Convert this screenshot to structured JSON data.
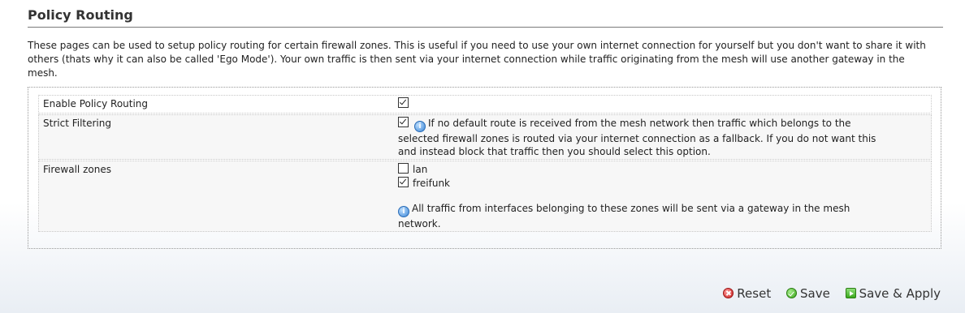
{
  "page": {
    "title": "Policy Routing",
    "description": "These pages can be used to setup policy routing for certain firewall zones. This is useful if you need to use your own internet connection for yourself but you don't want to share it with others (thats why it can also be called 'Ego Mode'). Your own traffic is then sent via your internet connection while traffic originating from the mesh will use another gateway in the mesh."
  },
  "form": {
    "enable": {
      "label": "Enable Policy Routing",
      "checked": true
    },
    "strict": {
      "label": "Strict Filtering",
      "checked": true,
      "help": "If no default route is received from the mesh network then traffic which belongs to the selected firewall zones is routed via your internet connection as a fallback. If you do not want this and instead block that traffic then you should select this option."
    },
    "zones": {
      "label": "Firewall zones",
      "items": [
        {
          "name": "lan",
          "checked": false
        },
        {
          "name": "freifunk",
          "checked": true
        }
      ],
      "help": "All traffic from interfaces belonging to these zones will be sent via a gateway in the mesh network."
    }
  },
  "actions": {
    "reset": "Reset",
    "save": "Save",
    "save_apply": "Save & Apply"
  },
  "icons": {
    "help": "help-icon",
    "reset": "reset-icon",
    "save": "save-icon",
    "save_apply": "save-apply-icon"
  },
  "colors": {
    "reset": "#c91e1e",
    "save": "#38a318",
    "help": "#3a85d6"
  }
}
